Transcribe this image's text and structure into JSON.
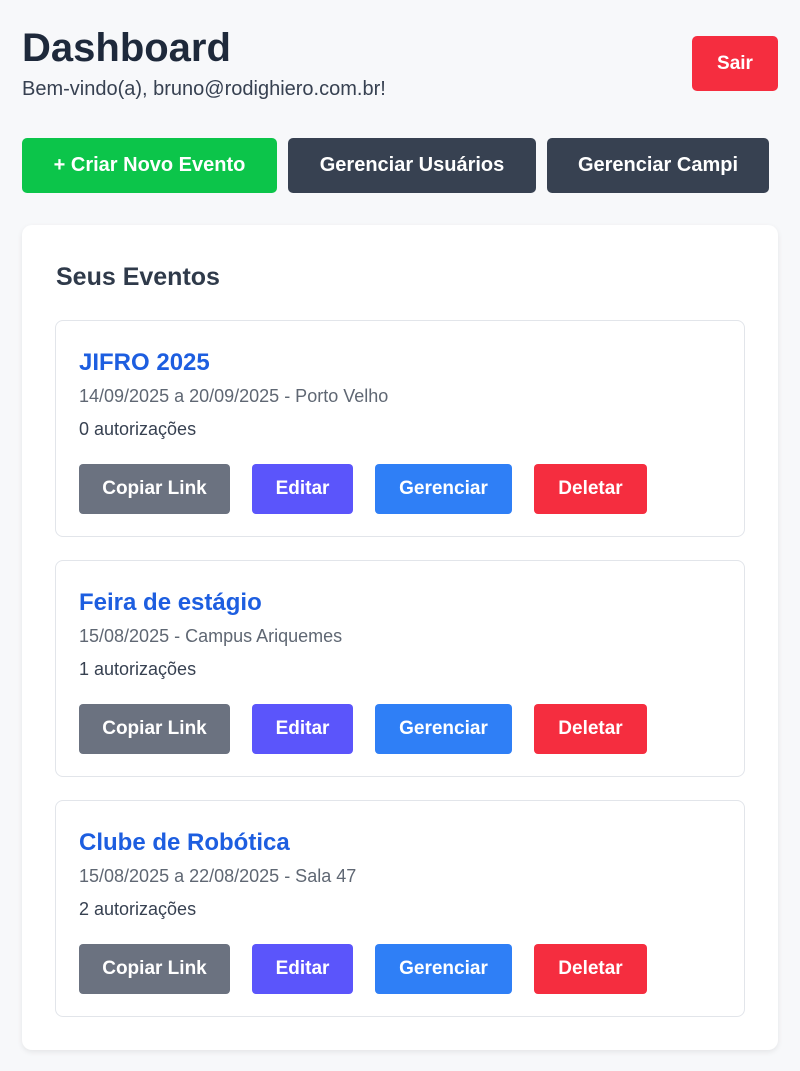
{
  "header": {
    "title": "Dashboard",
    "welcome": "Bem-vindo(a), bruno@rodighiero.com.br!",
    "logout_label": "Sair"
  },
  "actions": {
    "create_event": "+ Criar Novo Evento",
    "manage_users": "Gerenciar Usuários",
    "manage_campi": "Gerenciar Campi"
  },
  "events_section": {
    "title": "Seus Eventos",
    "button_labels": {
      "copy": "Copiar Link",
      "edit": "Editar",
      "manage": "Gerenciar",
      "delete": "Deletar"
    },
    "events": [
      {
        "title": "JIFRO 2025",
        "meta": "14/09/2025 a 20/09/2025 - Porto Velho",
        "count": "0 autorizações"
      },
      {
        "title": "Feira de estágio",
        "meta": "15/08/2025 - Campus Ariquemes",
        "count": "1 autorizações"
      },
      {
        "title": "Clube de Robótica",
        "meta": "15/08/2025 a 22/08/2025 - Sala 47",
        "count": "2 autorizações"
      }
    ]
  },
  "colors": {
    "primary_green": "#0cc54a",
    "dark": "#374151",
    "danger": "#f52d3f",
    "edit": "#5b55fb",
    "manage": "#2f7ff6",
    "copy": "#6b7280",
    "link_blue": "#1d5ee0"
  }
}
